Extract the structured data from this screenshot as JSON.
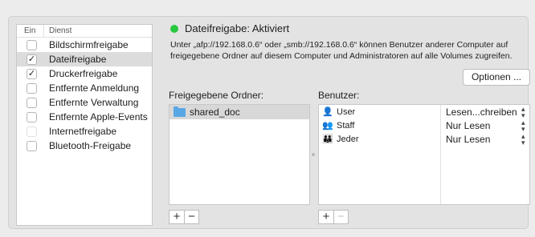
{
  "services": {
    "header": {
      "on": "Ein",
      "service": "Dienst"
    },
    "items": [
      {
        "label": "Bildschirmfreigabe",
        "checked": false,
        "selected": false
      },
      {
        "label": "Dateifreigabe",
        "checked": true,
        "selected": true
      },
      {
        "label": "Druckerfreigabe",
        "checked": true,
        "selected": false
      },
      {
        "label": "Entfernte Anmeldung",
        "checked": false,
        "selected": false
      },
      {
        "label": "Entfernte Verwaltung",
        "checked": false,
        "selected": false
      },
      {
        "label": "Entfernte Apple-Events",
        "checked": false,
        "selected": false
      },
      {
        "label": "Internetfreigabe",
        "checked": false,
        "selected": false
      },
      {
        "label": "Bluetooth-Freigabe",
        "checked": false,
        "selected": false
      }
    ]
  },
  "status": {
    "text": "Dateifreigabe: Aktiviert",
    "color": "#28c840",
    "description": "Unter „afp://192.168.0.6“ oder „smb://192.168.0.6“ können Benutzer anderer Computer auf freigegebene Ordner auf diesem Computer und Administratoren auf alle Volumes zugreifen."
  },
  "options_button": "Optionen ...",
  "shared_folders": {
    "label": "Freigegebene Ordner:",
    "items": [
      "shared_doc"
    ]
  },
  "users": {
    "label": "Benutzer:",
    "rows": [
      {
        "name": "User",
        "icon": "single-user-icon",
        "permission": "Lesen...chreiben"
      },
      {
        "name": "Staff",
        "icon": "group-icon",
        "permission": "Nur Lesen"
      },
      {
        "name": "Jeder",
        "icon": "everyone-icon",
        "permission": "Nur Lesen"
      }
    ]
  },
  "buttons": {
    "add": "+",
    "remove": "−"
  }
}
